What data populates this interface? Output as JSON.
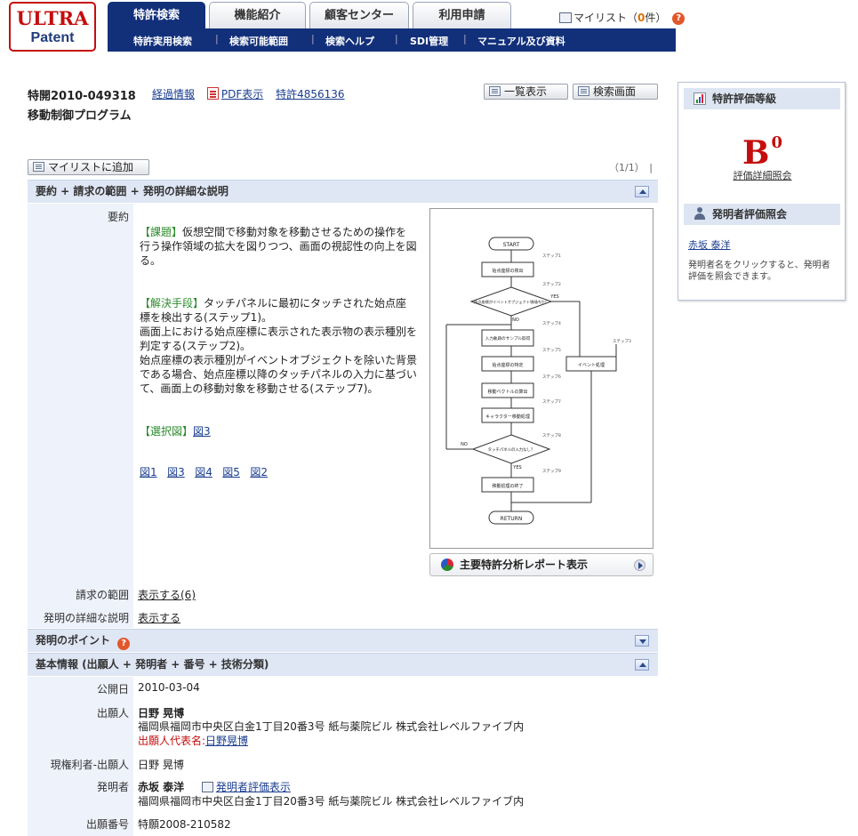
{
  "logo": {
    "line1": "ULTRA",
    "line2": "Patent"
  },
  "tabs": [
    {
      "label": "特許検索",
      "active": true
    },
    {
      "label": "機能紹介"
    },
    {
      "label": "顧客センター"
    },
    {
      "label": "利用申請"
    }
  ],
  "subnav": [
    "特許実用検索",
    "検索可能範囲",
    "検索ヘルプ",
    "SDI管理",
    "マニュアル及び資料"
  ],
  "mylist_top": {
    "label_pre": "マイリスト（",
    "count": "0",
    "label_post": "件）"
  },
  "doc": {
    "number": "特開2010-049318",
    "history_link": "経過情報",
    "pdf_link": "PDF表示",
    "patent_link": "特許4856136",
    "title": "移動制御プログラム",
    "list_button": "一覧表示",
    "search_button": "検索画面",
    "add_mylist_button": "マイリストに追加",
    "page_count": "（1/1）　|"
  },
  "sections": {
    "summary_bar": "要約 + 請求の範囲 + 発明の詳細な説明",
    "points_bar": "発明のポイント",
    "basic_bar": "基本情報 (出願人 + 発明者 + 番号 + 技術分類)"
  },
  "abstract": {
    "label": "要約",
    "problem_tag": "【課題】",
    "problem_text": "仮想空間で移動対象を移動させるための操作を行う操作領域の拡大を図りつつ、画面の視認性の向上を図る。",
    "solution_tag": "【解決手段】",
    "solution_1": "タッチパネルに最初にタッチされた始点座標を検出する(ステップ1)。",
    "solution_2": "画面上における始点座標に表示された表示物の表示種別を判定する(ステップ2)。",
    "solution_3": "始点座標の表示種別がイベントオブジェクトを除いた背景である場合、始点座標以降のタッチパネルの入力に基づいて、画面上の移動対象を移動させる(ステップ7)。",
    "selected_tag": "【選択図】",
    "selected_link": "図3",
    "figure_links": [
      "図1",
      "図3",
      "図4",
      "図5",
      "図2"
    ]
  },
  "flowchart": {
    "start": "START",
    "end": "RETURN",
    "yes": "YES",
    "no": "NO",
    "steps": [
      {
        "label": "始点座標の検出",
        "step": "ステップ1"
      },
      {
        "label": "始点座標がイベントオブジェクト領域内か？",
        "step": "ステップ2"
      },
      {
        "label": "入力軌跡のサンプル取得",
        "step": "ステップ4"
      },
      {
        "label": "始点座標の特定",
        "step": "ステップ5"
      },
      {
        "label": "移動ベクトルの算出",
        "step": "ステップ6"
      },
      {
        "label": "キャラクター移動処理",
        "step": "ステップ7"
      },
      {
        "label": "タッチパネルの入力なし？",
        "step": "ステップ8"
      },
      {
        "label": "移動処理の終了",
        "step": "ステップ9"
      },
      {
        "label": "イベント処理",
        "step": "ステップ3"
      }
    ]
  },
  "report_button": "主要特許分析レポート表示",
  "claims": {
    "label": "請求の範囲",
    "link": "表示する(6)"
  },
  "details": {
    "label": "発明の詳細な説明",
    "link": "表示する"
  },
  "basic": {
    "pub_date_label": "公開日",
    "pub_date": "2010-03-04",
    "applicant_label": "出願人",
    "applicant_name": "日野 晃博",
    "applicant_addr": "福岡県福岡市中央区白金1丁目20番3号 紙与薬院ビル 株式会社レベルファイブ内",
    "applicant_rep_label": "出願人代表名:",
    "applicant_rep": "日野晃博",
    "holder_label": "現権利者-出願人",
    "holder": "日野 晃博",
    "inventor_label": "発明者",
    "inventor_name": "赤坂 泰洋",
    "inventor_eval_link": "発明者評価表示",
    "inventor_addr": "福岡県福岡市中央区白金1丁目20番3号 紙与薬院ビル 株式会社レベルファイブ内",
    "app_no_label": "出願番号",
    "app_no": "特願2008-210582"
  },
  "sidebar": {
    "grade_header": "特許評価等級",
    "grade": "B",
    "grade_sup": "0",
    "grade_link": "評価詳細照会",
    "inventor_header": "発明者評価照会",
    "inventor_link": "赤坂 泰洋",
    "inventor_note": "発明者名をクリックすると、発明者評価を照会できます。"
  },
  "colors": {
    "navy": "#12307a",
    "red": "#c40d0d",
    "section": "#dfe6f4"
  }
}
